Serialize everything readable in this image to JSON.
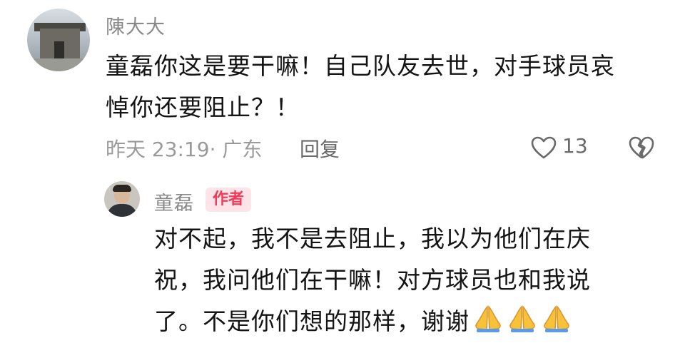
{
  "comment": {
    "username": "陳大大",
    "text_line1": "童磊你这是要干嘛！自己队友去世，对手球员哀",
    "text_line2": "悼你还要阻止？！",
    "time_location": "昨天 23:19· 广东",
    "reply_label": "回复",
    "like_count": "13",
    "icons": {
      "like": "heart-outline-icon",
      "dislike": "broken-heart-icon"
    }
  },
  "reply": {
    "username": "童磊",
    "badge": "作者",
    "text_line1": "对不起，我不是去阻止，我以为他们在庆",
    "text_line2": "祝，我问他们在干嘛！对方球员也和我说",
    "text_line3": "了。不是你们想的那样，谢谢",
    "emoji_icon": "folded-hands-icon",
    "emoji_count": 3
  },
  "colors": {
    "badge_text": "#f03c5a",
    "badge_bg": "#fde4e8",
    "meta": "#9a9a9a"
  }
}
